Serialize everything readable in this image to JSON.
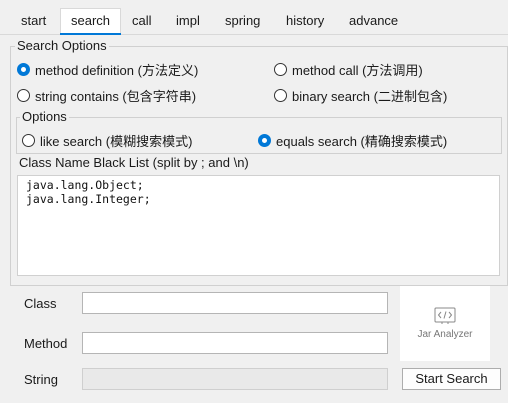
{
  "tabs": [
    {
      "label": "start",
      "active": false
    },
    {
      "label": "search",
      "active": true
    },
    {
      "label": "call",
      "active": false
    },
    {
      "label": "impl",
      "active": false
    },
    {
      "label": "spring",
      "active": false
    },
    {
      "label": "history",
      "active": false
    },
    {
      "label": "advance",
      "active": false
    }
  ],
  "search_options": {
    "title": "Search Options",
    "modes": [
      {
        "label": "method definition (方法定义)",
        "checked": true
      },
      {
        "label": "method call (方法调用)",
        "checked": false
      },
      {
        "label": "string contains (包含字符串)",
        "checked": false
      },
      {
        "label": "binary search (二进制包含)",
        "checked": false
      }
    ],
    "options": {
      "title": "Options",
      "match": [
        {
          "label": "like search (模糊搜索模式)",
          "checked": false
        },
        {
          "label": "equals search (精确搜索模式)",
          "checked": true
        }
      ]
    },
    "blacklist": {
      "label": "Class Name Black List (split by ; and \\n)",
      "value": "java.lang.Object;\njava.lang.Integer;"
    }
  },
  "form": {
    "class_label": "Class",
    "class_value": "",
    "method_label": "Method",
    "method_value": "",
    "string_label": "String",
    "string_value": "",
    "string_enabled": false
  },
  "logo": {
    "text": "Jar Analyzer",
    "icon": "code-icon"
  },
  "start_button": {
    "label": "Start Search"
  },
  "colors": {
    "accent": "#0078d7",
    "background": "#f0f0f0"
  }
}
